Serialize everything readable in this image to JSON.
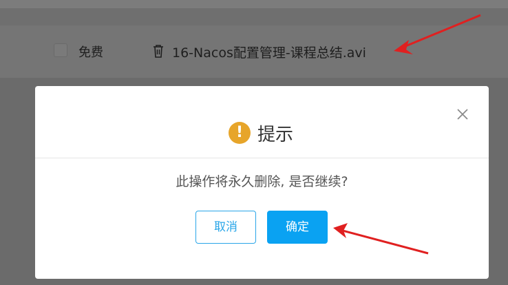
{
  "background_row": {
    "free_label": "免费",
    "file_name": "16-Nacos配置管理-课程总结.avi"
  },
  "dialog": {
    "title": "提示",
    "warning_glyph": "!",
    "message": "此操作将永久删除, 是否继续?",
    "cancel_label": "取消",
    "confirm_label": "确定"
  },
  "colors": {
    "accent": "#0aa2f2",
    "warning": "#e7a52a",
    "annotation_red": "#e02020"
  },
  "icons": [
    "trash-icon",
    "close-icon",
    "warning-icon",
    "arrow-annotation"
  ]
}
